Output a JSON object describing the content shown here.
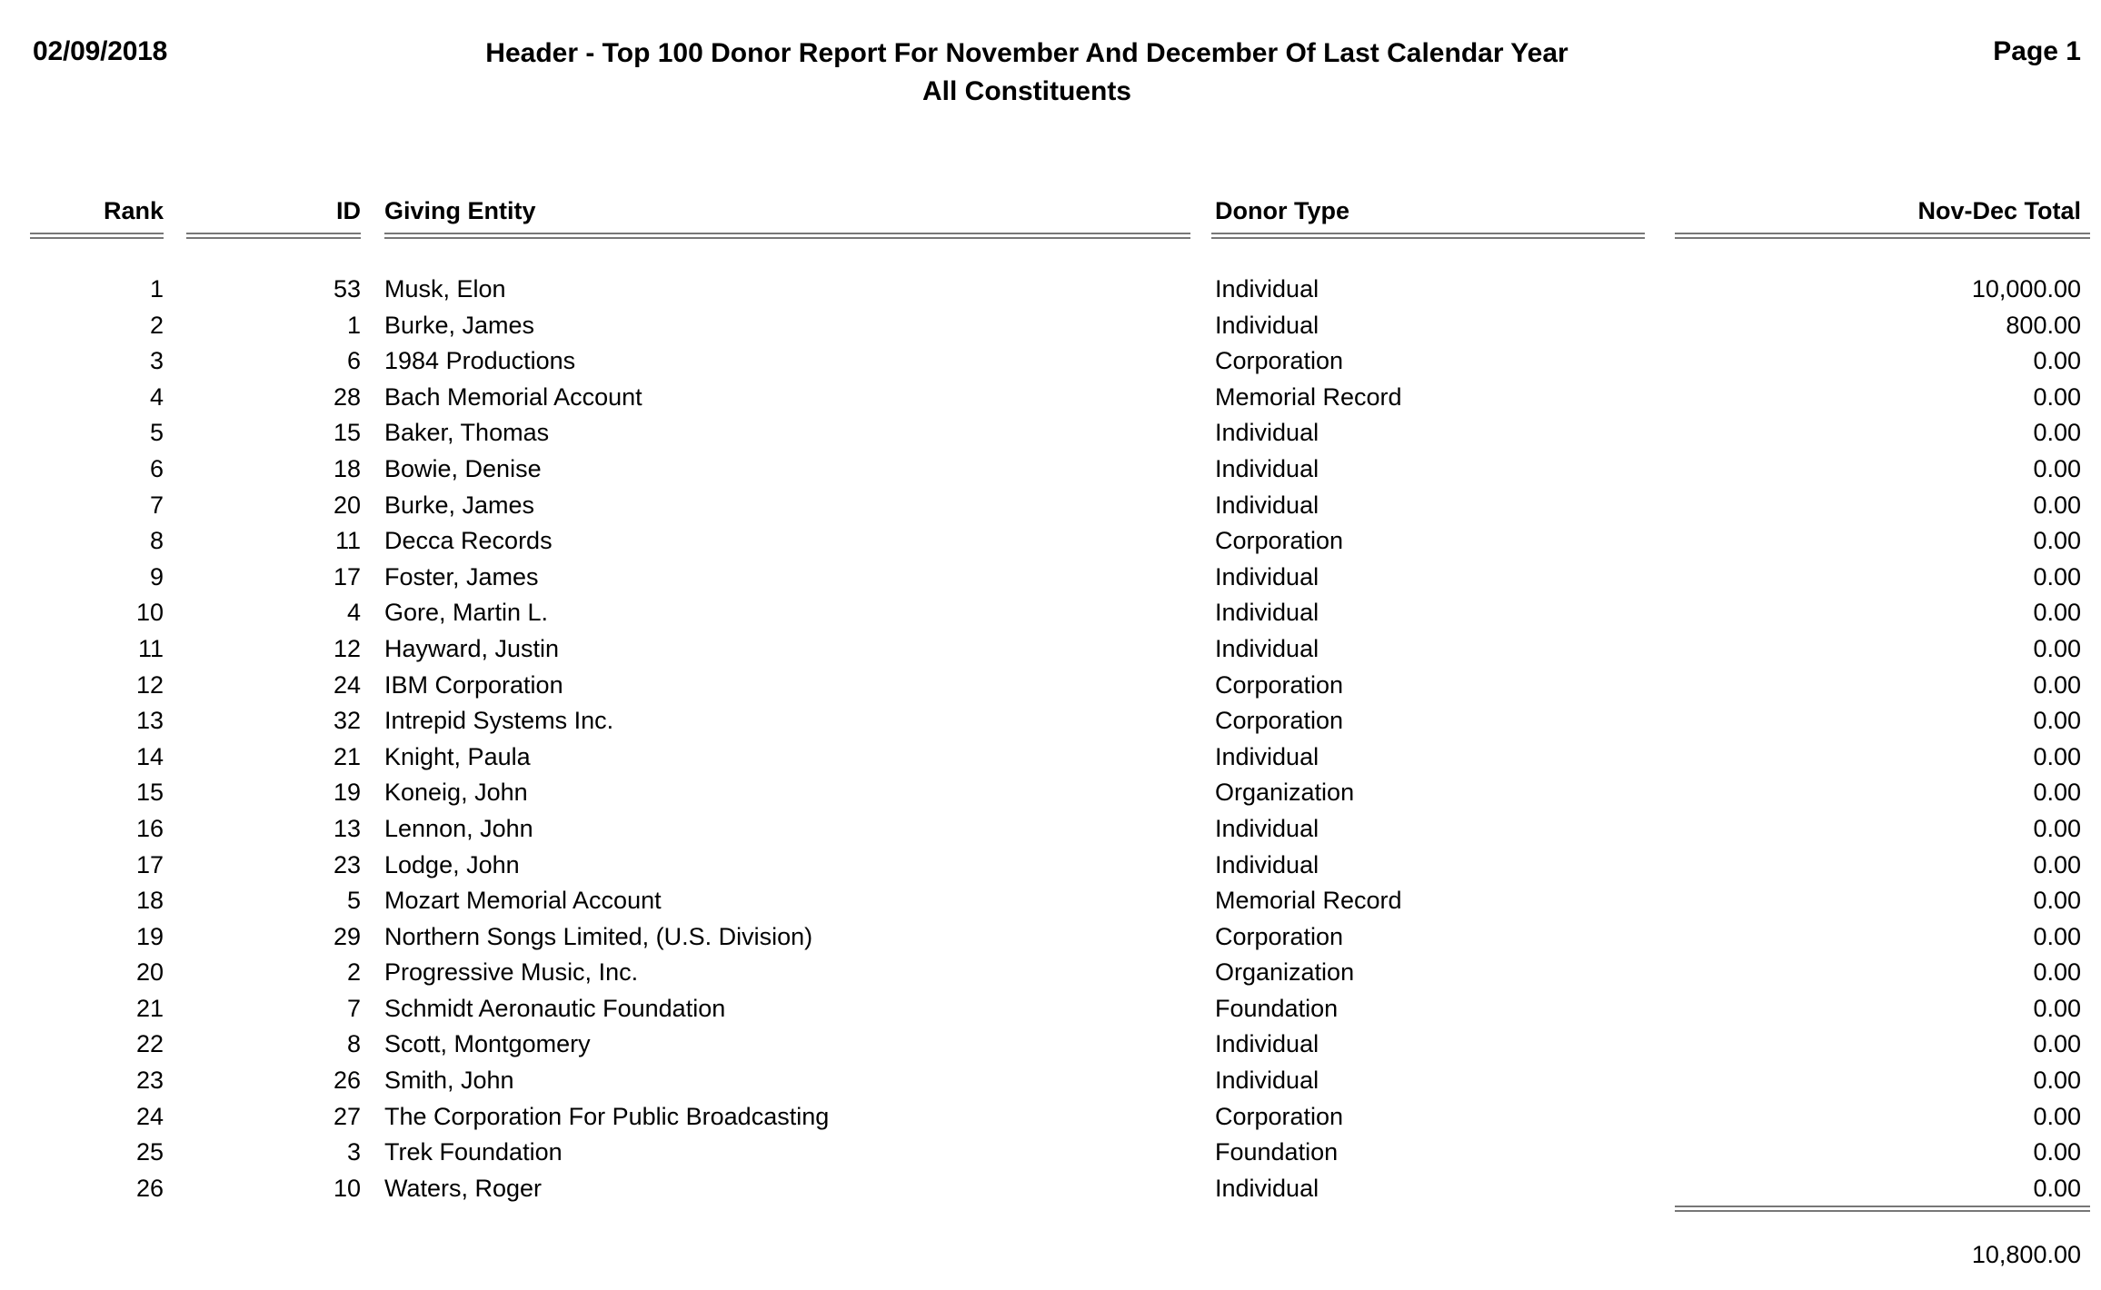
{
  "header": {
    "date": "02/09/2018",
    "title_line1": "Header - Top 100 Donor Report For November And December Of Last Calendar Year",
    "title_line2": "All Constituents",
    "page_label": "Page 1"
  },
  "table": {
    "columns": {
      "rank": "Rank",
      "id": "ID",
      "entity": "Giving Entity",
      "donor_type": "Donor Type",
      "total": "Nov-Dec Total"
    },
    "rows": [
      {
        "rank": "1",
        "id": "53",
        "entity": "Musk, Elon",
        "donor_type": "Individual",
        "total": "10,000.00"
      },
      {
        "rank": "2",
        "id": "1",
        "entity": "Burke, James",
        "donor_type": "Individual",
        "total": "800.00"
      },
      {
        "rank": "3",
        "id": "6",
        "entity": "1984 Productions",
        "donor_type": "Corporation",
        "total": "0.00"
      },
      {
        "rank": "4",
        "id": "28",
        "entity": "Bach Memorial Account",
        "donor_type": "Memorial Record",
        "total": "0.00"
      },
      {
        "rank": "5",
        "id": "15",
        "entity": "Baker, Thomas",
        "donor_type": "Individual",
        "total": "0.00"
      },
      {
        "rank": "6",
        "id": "18",
        "entity": "Bowie, Denise",
        "donor_type": "Individual",
        "total": "0.00"
      },
      {
        "rank": "7",
        "id": "20",
        "entity": "Burke, James",
        "donor_type": "Individual",
        "total": "0.00"
      },
      {
        "rank": "8",
        "id": "11",
        "entity": "Decca Records",
        "donor_type": "Corporation",
        "total": "0.00"
      },
      {
        "rank": "9",
        "id": "17",
        "entity": "Foster, James",
        "donor_type": "Individual",
        "total": "0.00"
      },
      {
        "rank": "10",
        "id": "4",
        "entity": "Gore, Martin L.",
        "donor_type": "Individual",
        "total": "0.00"
      },
      {
        "rank": "11",
        "id": "12",
        "entity": "Hayward, Justin",
        "donor_type": "Individual",
        "total": "0.00"
      },
      {
        "rank": "12",
        "id": "24",
        "entity": "IBM Corporation",
        "donor_type": "Corporation",
        "total": "0.00"
      },
      {
        "rank": "13",
        "id": "32",
        "entity": "Intrepid Systems Inc.",
        "donor_type": "Corporation",
        "total": "0.00"
      },
      {
        "rank": "14",
        "id": "21",
        "entity": "Knight, Paula",
        "donor_type": "Individual",
        "total": "0.00"
      },
      {
        "rank": "15",
        "id": "19",
        "entity": "Koneig, John",
        "donor_type": "Organization",
        "total": "0.00"
      },
      {
        "rank": "16",
        "id": "13",
        "entity": "Lennon, John",
        "donor_type": "Individual",
        "total": "0.00"
      },
      {
        "rank": "17",
        "id": "23",
        "entity": "Lodge, John",
        "donor_type": "Individual",
        "total": "0.00"
      },
      {
        "rank": "18",
        "id": "5",
        "entity": "Mozart Memorial Account",
        "donor_type": "Memorial Record",
        "total": "0.00"
      },
      {
        "rank": "19",
        "id": "29",
        "entity": "Northern Songs Limited, (U.S. Division)",
        "donor_type": "Corporation",
        "total": "0.00"
      },
      {
        "rank": "20",
        "id": "2",
        "entity": "Progressive Music, Inc.",
        "donor_type": "Organization",
        "total": "0.00"
      },
      {
        "rank": "21",
        "id": "7",
        "entity": "Schmidt Aeronautic Foundation",
        "donor_type": "Foundation",
        "total": "0.00"
      },
      {
        "rank": "22",
        "id": "8",
        "entity": "Scott, Montgomery",
        "donor_type": "Individual",
        "total": "0.00"
      },
      {
        "rank": "23",
        "id": "26",
        "entity": "Smith, John",
        "donor_type": "Individual",
        "total": "0.00"
      },
      {
        "rank": "24",
        "id": "27",
        "entity": "The Corporation For Public Broadcasting",
        "donor_type": "Corporation",
        "total": "0.00"
      },
      {
        "rank": "25",
        "id": "3",
        "entity": "Trek Foundation",
        "donor_type": "Foundation",
        "total": "0.00"
      },
      {
        "rank": "26",
        "id": "10",
        "entity": "Waters, Roger",
        "donor_type": "Individual",
        "total": "0.00"
      }
    ],
    "grand_total": "10,800.00"
  },
  "colors": {
    "text": "#000000",
    "rule": "#777777",
    "background": "#ffffff"
  }
}
